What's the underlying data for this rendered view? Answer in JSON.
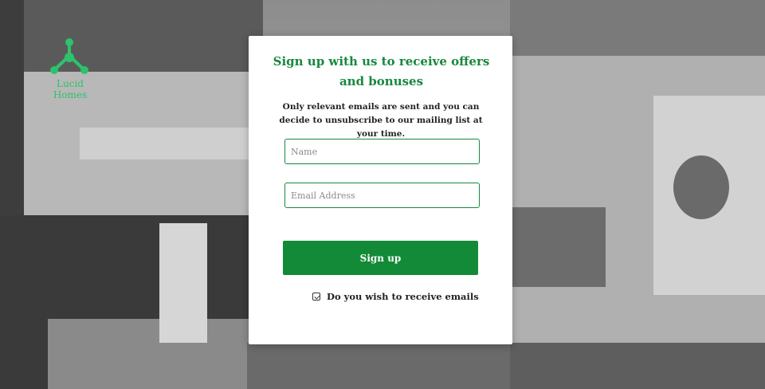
{
  "brand": {
    "name": "Lucid Homes",
    "logo_icon": "network-nodes-icon",
    "color": "#2cc36b"
  },
  "signup": {
    "title": "Sign up with  us to receive offers and bonuses",
    "subtitle": "Only relevant emails are sent and you can decide to unsubscribe to our mailing list at your time.",
    "name_placeholder": "Name",
    "name_value": "",
    "email_placeholder": "Email Address",
    "email_value": "",
    "submit_label": "Sign up",
    "consent_label": "Do you wish to receive emails",
    "consent_checked": true,
    "accent_color": "#17883e",
    "button_color": "#128a37"
  }
}
